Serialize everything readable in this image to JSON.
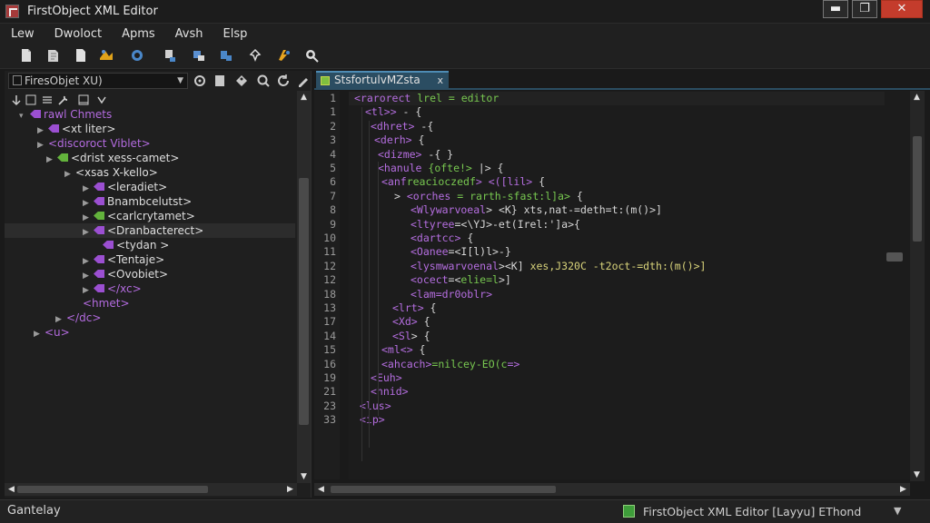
{
  "window": {
    "title": "FirstObject XML Editor",
    "min_label": "▬",
    "max_label": "❐",
    "close_label": "✕"
  },
  "menu": [
    "Lew",
    "Dwoloct",
    "Apms",
    "Avsh",
    "Elsp"
  ],
  "left": {
    "combo_text": "FiresObjet XU)",
    "tree": [
      {
        "label": "rawl Chmets",
        "color": "purple",
        "icon": "purple",
        "expander": "▾"
      },
      {
        "label": "<xt liter>",
        "color": "white",
        "icon": "purple",
        "expander": "▶"
      },
      {
        "label": "<discoroct Viblet>",
        "color": "purple",
        "icon": "none",
        "expander": "▶"
      },
      {
        "label": "<drist xess-camet>",
        "color": "white",
        "icon": "green",
        "expander": "▶"
      },
      {
        "label": "<xsas X-kello>",
        "color": "white",
        "icon": "none",
        "expander": "▶"
      },
      {
        "label": "<leradiet>",
        "color": "white",
        "icon": "purple",
        "expander": "▶"
      },
      {
        "label": "Bnambcelutst>",
        "color": "white",
        "icon": "purple",
        "expander": "▶"
      },
      {
        "label": "<carlcrytamet>",
        "color": "white",
        "icon": "purple",
        "expander": "▶"
      },
      {
        "label": "<Dranbacterect>",
        "color": "white",
        "icon": "purple",
        "expander": "▶"
      },
      {
        "label": "<tydan >",
        "color": "white",
        "icon": "purple",
        "expander": ""
      },
      {
        "label": "<Tentaje>",
        "color": "white",
        "icon": "purple",
        "expander": "▶"
      },
      {
        "label": "<Ovobiet>",
        "color": "white",
        "icon": "purple",
        "expander": "▶"
      },
      {
        "label": "</xc>",
        "color": "purple",
        "icon": "purple",
        "expander": "▶"
      },
      {
        "label": "<hmet>",
        "color": "purple",
        "icon": "none",
        "expander": ""
      },
      {
        "label": "</dc>",
        "color": "purple",
        "icon": "none",
        "expander": "▶"
      },
      {
        "label": "<u>",
        "color": "purple",
        "icon": "none",
        "expander": "▶"
      }
    ]
  },
  "editor": {
    "tab_label": "StsfortulvMZsta",
    "tab_close": "x",
    "line_numbers": [
      "1",
      "1",
      "2",
      "3",
      "4",
      "5",
      "6",
      "7",
      "8",
      "9",
      "10",
      "11",
      "12",
      "12",
      "18",
      "13",
      "17",
      "14",
      "15",
      "16",
      "19",
      "21",
      "23",
      "33"
    ],
    "lines": [
      [
        {
          "c": "p",
          "t": "<rarorect "
        },
        {
          "c": "g",
          "t": "lrel = editor"
        }
      ],
      [
        {
          "c": "p",
          "t": "<tl>> "
        },
        {
          "c": "w",
          "t": "- {"
        }
      ],
      [
        {
          "c": "p",
          "t": "<dhret> "
        },
        {
          "c": "w",
          "t": "-{"
        }
      ],
      [
        {
          "c": "p",
          "t": "<derh> "
        },
        {
          "c": "w",
          "t": "{"
        }
      ],
      [
        {
          "c": "p",
          "t": "<dizme> "
        },
        {
          "c": "w",
          "t": "-{              }"
        }
      ],
      [
        {
          "c": "p",
          "t": "<hanule "
        },
        {
          "c": "g",
          "t": "{ofte!> "
        },
        {
          "c": "w",
          "t": "|> {"
        }
      ],
      [
        {
          "c": "p",
          "t": "<anf"
        },
        {
          "c": "g",
          "t": "reacioczedf"
        },
        {
          "c": "p",
          "t": "> <([lil> "
        },
        {
          "c": "w",
          "t": "{"
        }
      ],
      [
        {
          "c": "w",
          "t": "> "
        },
        {
          "c": "p",
          "t": "<orches "
        },
        {
          "c": "g",
          "t": "= rarth-sfast:l]a> "
        },
        {
          "c": "w",
          "t": "{"
        }
      ],
      [
        {
          "c": "p",
          "t": "<Wlywarvoeal"
        },
        {
          "c": "w",
          "t": "> <K} xts,nat-=deth=t:(m()>]"
        }
      ],
      [
        {
          "c": "p",
          "t": "<ltyree"
        },
        {
          "c": "w",
          "t": "=<\\YJ>-et(Irel:']a>{"
        }
      ],
      [
        {
          "c": "p",
          "t": "<dartcc> "
        },
        {
          "c": "w",
          "t": "{"
        }
      ],
      [
        {
          "c": "p",
          "t": "<Oanee"
        },
        {
          "c": "w",
          "t": "=<I[l)l>-}"
        }
      ],
      [
        {
          "c": "p",
          "t": "<lysmwarvoenal"
        },
        {
          "c": "w",
          "t": "><K] "
        },
        {
          "c": "y",
          "t": "xes,J320C -t2oct-=dth:(m()>]"
        }
      ],
      [
        {
          "c": "p",
          "t": "<ocect"
        },
        {
          "c": "w",
          "t": "=<"
        },
        {
          "c": "g",
          "t": "elie=l"
        },
        {
          "c": "w",
          "t": ">]"
        }
      ],
      [
        {
          "c": "p",
          "t": "<lam=dr0oblr>"
        }
      ],
      [
        {
          "c": "p",
          "t": "<lrt> "
        },
        {
          "c": "w",
          "t": "{"
        }
      ],
      [
        {
          "c": "p",
          "t": "<Xd> "
        },
        {
          "c": "w",
          "t": "{"
        }
      ],
      [
        {
          "c": "p",
          "t": "<Sl"
        },
        {
          "c": "w",
          "t": ">  {"
        }
      ],
      [
        {
          "c": "p",
          "t": "<ml<> "
        },
        {
          "c": "w",
          "t": "{"
        }
      ],
      [
        {
          "c": "p",
          "t": "<ahcach>"
        },
        {
          "c": "g",
          "t": "=nilcey-EO(c"
        },
        {
          "c": "p",
          "t": "=>"
        }
      ],
      [
        {
          "c": "p",
          "t": "<Euh>"
        }
      ],
      [
        {
          "c": "p",
          "t": "<hnid>"
        }
      ],
      [
        {
          "c": "p",
          "t": "<lus>"
        }
      ],
      [
        {
          "c": "p",
          "t": "<ip>"
        }
      ]
    ]
  },
  "status": {
    "left": "Gantelay",
    "right": "FirstObject XML Editor [Layyu] EThond",
    "dropdown": "▼"
  },
  "colors": {
    "accent": "#2b4d62",
    "tag_purple": "#b56ee0",
    "attr_green": "#78c850",
    "close_red": "#c43c2c"
  }
}
